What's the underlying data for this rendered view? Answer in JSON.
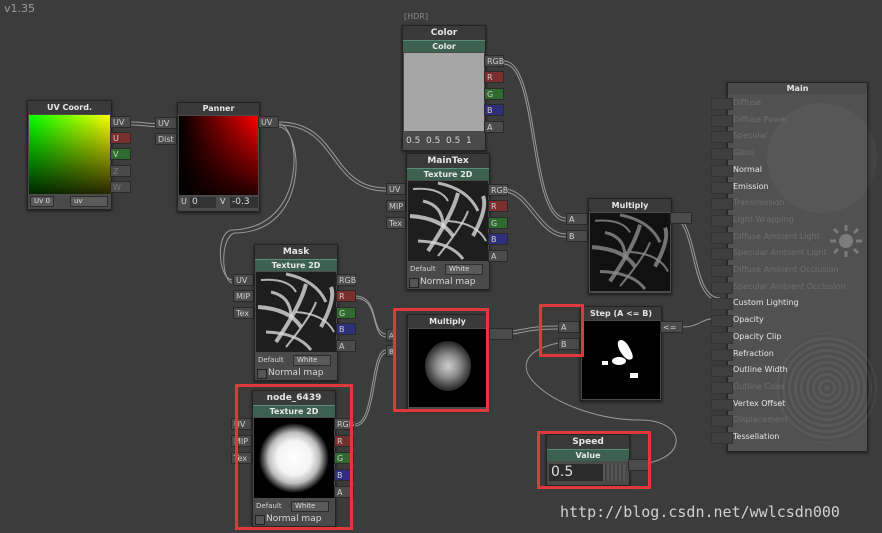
{
  "version": "v1.35",
  "hdr_label": "[HDR]",
  "watermark": "http://blog.csdn.net/wwlcsdn000",
  "colors": {
    "accent_green": "#3d6151",
    "highlight_red": "#e0393b",
    "port_red": "#7a2f2f",
    "port_green": "#2f6a2f",
    "port_blue": "#2f2f7a"
  },
  "nodes": {
    "uv_coord": {
      "title": "UV Coord.",
      "outputs": [
        "UV",
        "U",
        "V",
        "Z",
        "W"
      ],
      "dropdown1": "Uv 0",
      "dropdown2": "uv"
    },
    "panner": {
      "title": "Panner",
      "inputs": [
        "UV",
        "Dist"
      ],
      "output": "UV",
      "u_label": "U",
      "u_value": "0",
      "v_label": "V",
      "v_value": "-0.3"
    },
    "color": {
      "title": "Color",
      "subtitle": "Color",
      "outputs": [
        "RGB",
        "R",
        "G",
        "B",
        "A"
      ],
      "values": [
        "0.5",
        "0.5",
        "0.5",
        "1"
      ]
    },
    "maintex": {
      "title": "MainTex",
      "subtitle": "Texture 2D",
      "inputs": [
        "UV",
        "MIP",
        "Tex"
      ],
      "outputs": [
        "RGB",
        "R",
        "G",
        "B",
        "A"
      ],
      "default_label": "Default",
      "default_value": "White",
      "normal_map": "Normal map"
    },
    "mask": {
      "title": "Mask",
      "subtitle": "Texture 2D",
      "inputs": [
        "UV",
        "MIP",
        "Tex"
      ],
      "outputs": [
        "RGB",
        "R",
        "G",
        "B",
        "A"
      ],
      "default_label": "Default",
      "default_value": "White",
      "normal_map": "Normal map"
    },
    "node_6439": {
      "title": "node_6439",
      "subtitle": "Texture 2D",
      "inputs": [
        "UV",
        "MIP",
        "Tex"
      ],
      "outputs": [
        "RGB",
        "R",
        "G",
        "B",
        "A"
      ],
      "default_label": "Default",
      "default_value": "White",
      "normal_map": "Normal map"
    },
    "multiply_top": {
      "title": "Multiply",
      "inputs": [
        "A",
        "B"
      ]
    },
    "multiply_mid": {
      "title": "Multiply",
      "inputs": [
        "A",
        "B"
      ]
    },
    "step": {
      "title": "Step (A <= B)",
      "inputs": [
        "A",
        "B"
      ],
      "output": "<="
    },
    "speed": {
      "title": "Speed",
      "subtitle": "Value",
      "value": "0.5"
    }
  },
  "main": {
    "title": "Main",
    "items": [
      {
        "label": "Diffuse",
        "active": false
      },
      {
        "label": "Diffuse Power",
        "active": false
      },
      {
        "label": "Specular",
        "active": false
      },
      {
        "label": "Gloss",
        "active": false
      },
      {
        "label": "Normal",
        "active": true
      },
      {
        "label": "Emission",
        "active": true
      },
      {
        "label": "Transmission",
        "active": false
      },
      {
        "label": "Light Wrapping",
        "active": false
      },
      {
        "label": "Diffuse Ambient Light",
        "active": false
      },
      {
        "label": "Specular Ambient Light",
        "active": false
      },
      {
        "label": "Diffuse Ambient Occlusion",
        "active": false
      },
      {
        "label": "Specular Ambient Occlusion",
        "active": false
      },
      {
        "label": "Custom Lighting",
        "active": true
      },
      {
        "label": "Opacity",
        "active": true
      },
      {
        "label": "Opacity Clip",
        "active": true
      },
      {
        "label": "Refraction",
        "active": true
      },
      {
        "label": "Outline Width",
        "active": true
      },
      {
        "label": "Outline Color",
        "active": false
      },
      {
        "label": "Vertex Offset",
        "active": true
      },
      {
        "label": "Displacement",
        "active": false
      },
      {
        "label": "Tessellation",
        "active": true
      }
    ]
  }
}
